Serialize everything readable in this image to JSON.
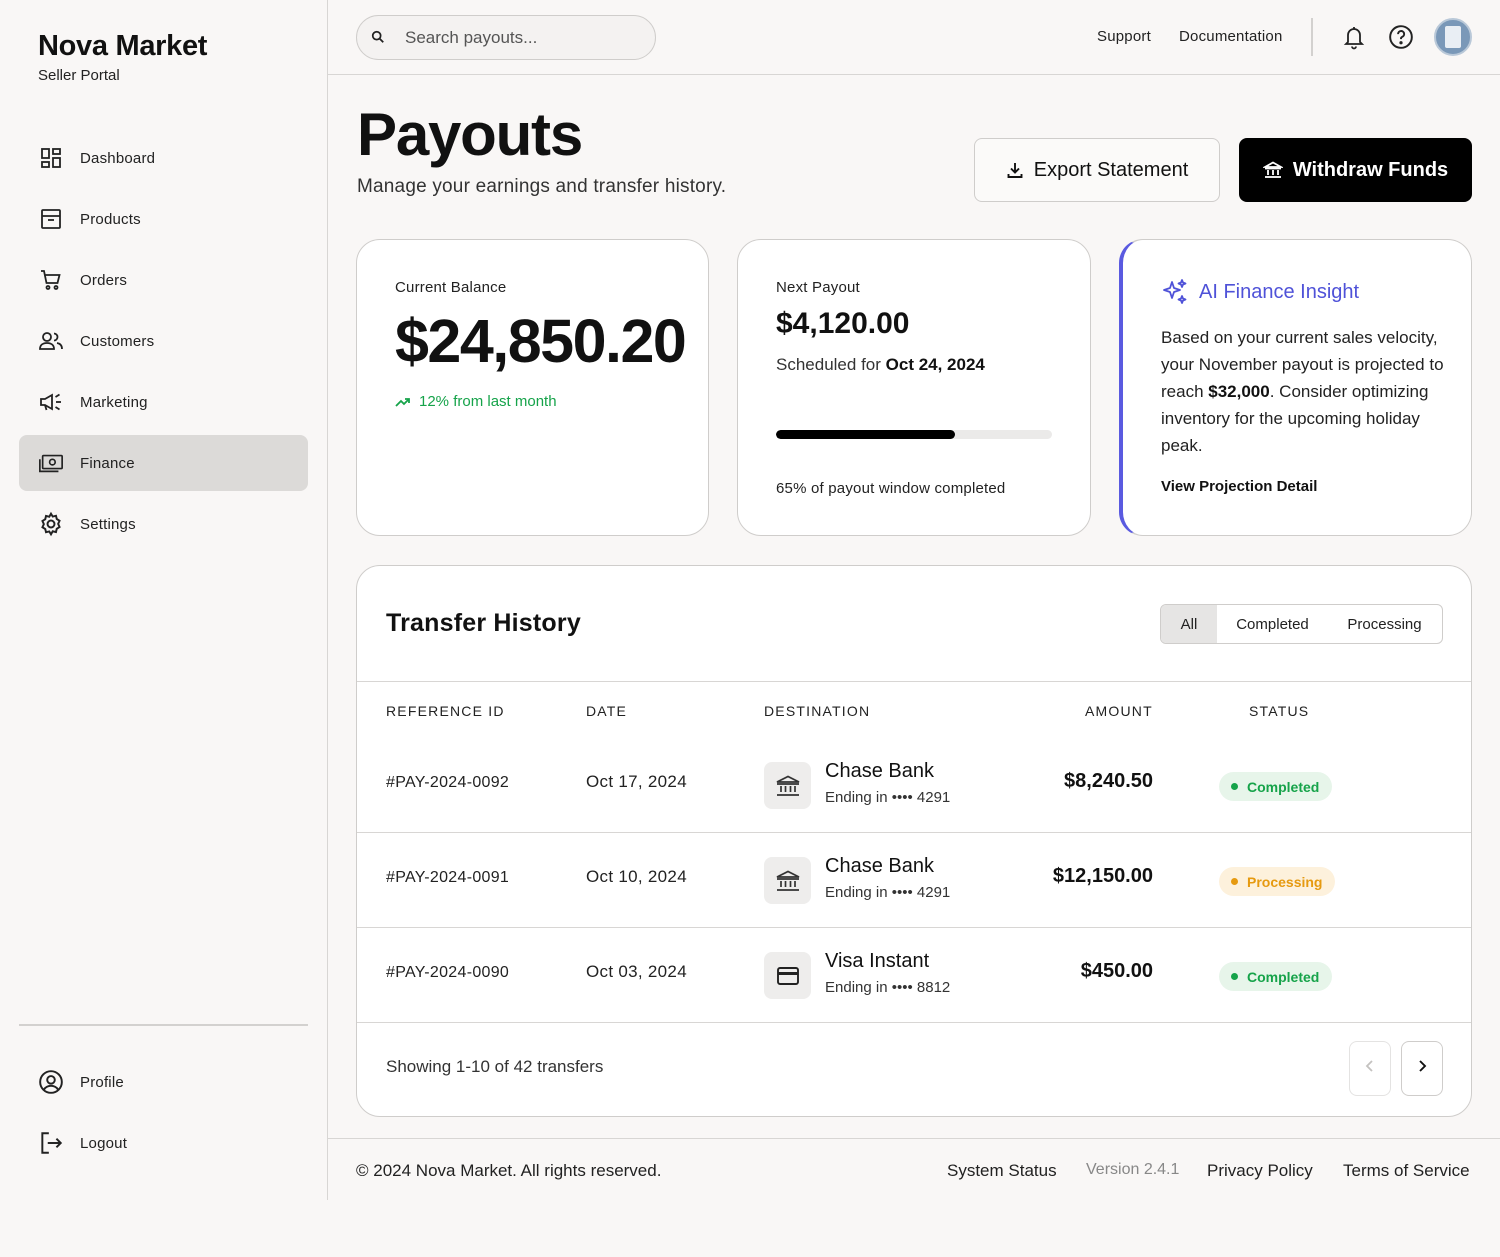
{
  "brand": {
    "title": "Nova Market",
    "subtitle": "Seller Portal"
  },
  "sidebar": {
    "items": [
      {
        "label": "Dashboard",
        "icon": "dashboard-icon"
      },
      {
        "label": "Products",
        "icon": "archive-icon"
      },
      {
        "label": "Orders",
        "icon": "cart-icon"
      },
      {
        "label": "Customers",
        "icon": "users-icon"
      },
      {
        "label": "Marketing",
        "icon": "megaphone-icon"
      },
      {
        "label": "Finance",
        "icon": "cash-icon",
        "active": true
      },
      {
        "label": "Settings",
        "icon": "gear-icon"
      }
    ],
    "bottom": [
      {
        "label": "Profile",
        "icon": "user-circle-icon"
      },
      {
        "label": "Logout",
        "icon": "logout-icon"
      }
    ]
  },
  "header": {
    "search_placeholder": "Search payouts...",
    "links": [
      "Support",
      "Documentation"
    ],
    "icons": [
      "bell-icon",
      "help-icon",
      "avatar"
    ]
  },
  "page": {
    "title": "Payouts",
    "subtitle": "Manage your earnings and transfer history.",
    "export_label": "Export Statement",
    "withdraw_label": "Withdraw Funds"
  },
  "balance": {
    "label": "Current Balance",
    "amount": "$24,850.20",
    "trend": "12% from last month"
  },
  "next_payout": {
    "label": "Next Payout",
    "amount": "$4,120.00",
    "scheduled_prefix": "Scheduled for",
    "scheduled_date": "Oct 24, 2024",
    "progress_percent": 65,
    "note": "65% of payout window completed"
  },
  "ai_insight": {
    "title": "AI Finance Insight",
    "text_1": "Based on your current sales velocity, your November payout is projected to reach",
    "highlight": "$32,000",
    "text_2": ". Consider optimizing inventory for the upcoming holiday peak.",
    "link": "View Projection Detail"
  },
  "history": {
    "title": "Transfer History",
    "filters": [
      "All",
      "Completed",
      "Processing"
    ],
    "active_filter": "All",
    "columns": [
      "REFERENCE ID",
      "DATE",
      "DESTINATION",
      "AMOUNT",
      "STATUS"
    ],
    "rows": [
      {
        "ref": "#PAY-2024-0092",
        "date": "Oct 17, 2024",
        "dest": "Chase Bank",
        "dest_sub": "Ending in •••• 4291",
        "dest_icon": "bank-icon",
        "amount": "$8,240.50",
        "status": "Completed"
      },
      {
        "ref": "#PAY-2024-0091",
        "date": "Oct 10, 2024",
        "dest": "Chase Bank",
        "dest_sub": "Ending in •••• 4291",
        "dest_icon": "bank-icon",
        "amount": "$12,150.00",
        "status": "Processing"
      },
      {
        "ref": "#PAY-2024-0090",
        "date": "Oct 03, 2024",
        "dest": "Visa Instant",
        "dest_sub": "Ending in •••• 8812",
        "dest_icon": "card-icon",
        "amount": "$450.00",
        "status": "Completed"
      }
    ],
    "footer": "Showing 1-10 of 42 transfers"
  },
  "footer": {
    "copyright": "© 2024 Nova Market. All rights reserved.",
    "system_status": "System Status",
    "version": "Version 2.4.1",
    "privacy": "Privacy Policy",
    "terms": "Terms of Service"
  },
  "colors": {
    "accent": "#4f52d8",
    "success": "#16a34a",
    "warning": "#e69a10",
    "primary_button": "#000000"
  }
}
